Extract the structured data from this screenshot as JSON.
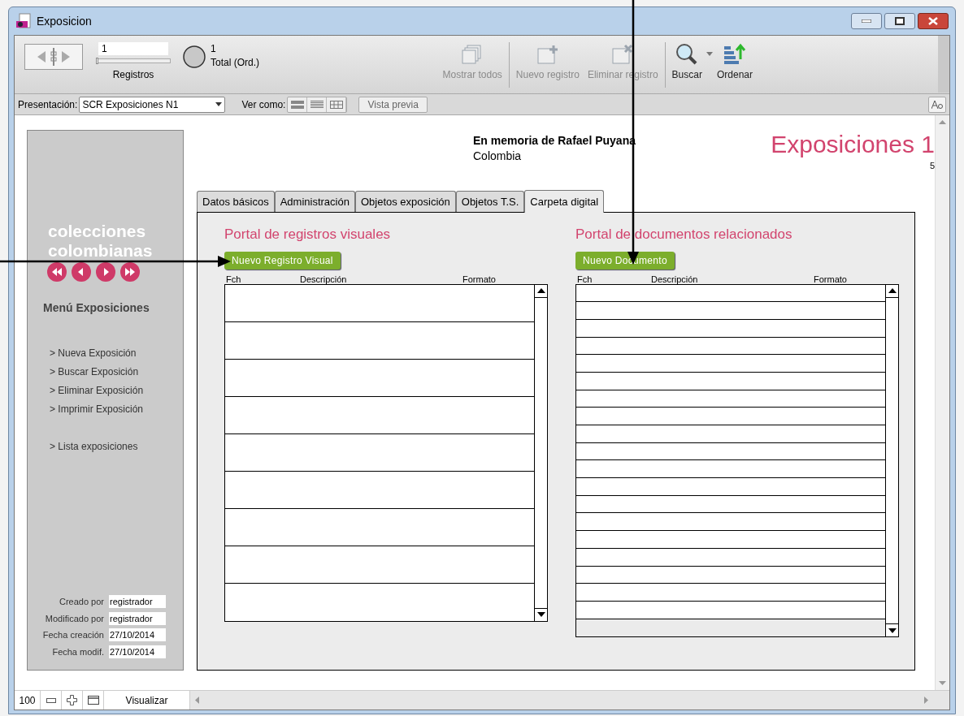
{
  "window": {
    "title": "Exposicion"
  },
  "toolbar": {
    "record_field": {
      "value": "1"
    },
    "record_slider": {
      "level": 0
    },
    "records_label": "Registros",
    "found": "1",
    "total_label": "Total (Ord.)",
    "buttons": [
      {
        "kind": "show-all",
        "label": "Mostrar todos",
        "disabled": true
      },
      {
        "kind": "new",
        "label": "Nuevo registro",
        "disabled": true
      },
      {
        "kind": "delete",
        "label": "Eliminar registro",
        "disabled": true
      },
      {
        "kind": "search",
        "label": "Buscar",
        "disabled": false
      },
      {
        "kind": "sort",
        "label": "Ordenar",
        "disabled": false
      }
    ]
  },
  "layout_bar": {
    "layout_label": "Presentación:",
    "layout_value": "SCR Exposiciones N1",
    "view_label": "Ver como:",
    "preview_button": "Vista previa"
  },
  "sidebar": {
    "brand": "colecciones colombianas",
    "menu_title": "Menú Exposiciones",
    "items": [
      {
        "label": "> Nueva Exposición"
      },
      {
        "label": "> Buscar Exposición"
      },
      {
        "label": "> Eliminar Exposición"
      },
      {
        "label": "> Imprimir Exposición"
      },
      {
        "label": "> Lista exposiciones"
      }
    ],
    "meta": [
      {
        "label": "Creado por",
        "value": "registrador"
      },
      {
        "label": "Modificado por",
        "value": "registrador"
      },
      {
        "label": "Fecha creación",
        "value": "27/10/2014"
      },
      {
        "label": "Fecha modif.",
        "value": "27/10/2014"
      }
    ]
  },
  "header": {
    "subtitle_bold": "En memoria de Rafael Puyana",
    "subtitle": "Colombia",
    "title": "Exposiciones 1",
    "count": "5"
  },
  "tabs": [
    {
      "label": "Datos básicos",
      "selected": false
    },
    {
      "label": "Administración",
      "selected": false
    },
    {
      "label": "Objetos exposición",
      "selected": false
    },
    {
      "label": "Objetos T.S.",
      "selected": false
    },
    {
      "label": "Carpeta digital",
      "selected": true
    }
  ],
  "portals": [
    {
      "kind": "tall",
      "title": "Portal de registros visuales",
      "button": "Nuevo Registro Visual",
      "columns": [
        "Fch",
        "Descripción",
        "Formato"
      ]
    },
    {
      "kind": "short",
      "title": "Portal de documentos relacionados",
      "button": "Nuevo Documento",
      "columns": [
        "Fch",
        "Descripción",
        "Formato"
      ]
    }
  ],
  "status_bar": {
    "zoom": "100",
    "mode": "Visualizar"
  }
}
